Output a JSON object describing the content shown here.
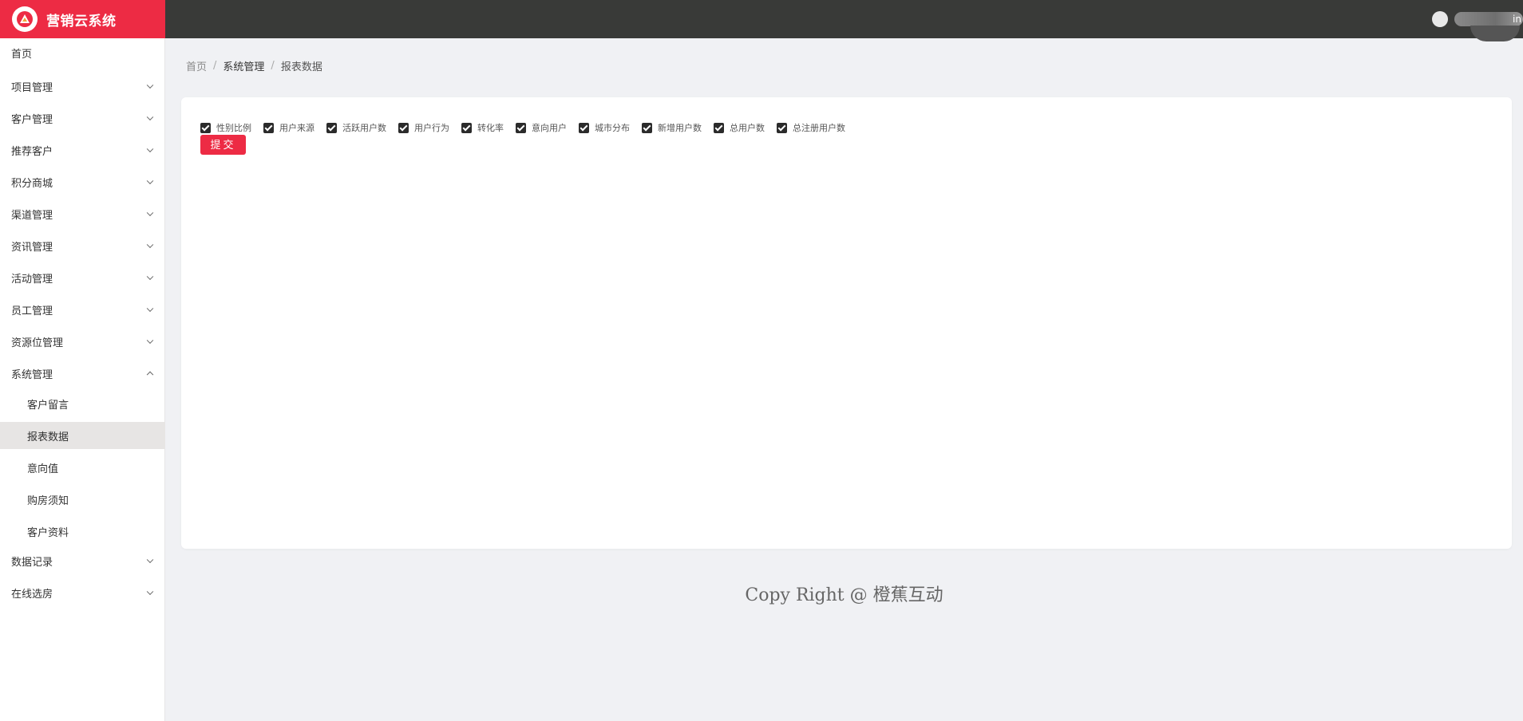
{
  "brand": {
    "title": "营销云系统",
    "logo_icon": "brand-triangle-logo"
  },
  "user": {
    "name_visible": "in"
  },
  "sidebar": {
    "items": [
      {
        "label": "首页",
        "expandable": false
      },
      {
        "label": "项目管理",
        "expandable": true
      },
      {
        "label": "客户管理",
        "expandable": true
      },
      {
        "label": "推荐客户",
        "expandable": true
      },
      {
        "label": "积分商城",
        "expandable": true
      },
      {
        "label": "渠道管理",
        "expandable": true
      },
      {
        "label": "资讯管理",
        "expandable": true
      },
      {
        "label": "活动管理",
        "expandable": true
      },
      {
        "label": "员工管理",
        "expandable": true
      },
      {
        "label": "资源位管理",
        "expandable": true
      },
      {
        "label": "系统管理",
        "expandable": true,
        "expanded": true
      },
      {
        "label": "数据记录",
        "expandable": true
      },
      {
        "label": "在线选房",
        "expandable": true
      }
    ],
    "system_children": [
      {
        "label": "客户留言"
      },
      {
        "label": "报表数据",
        "active": true
      },
      {
        "label": "意向值"
      },
      {
        "label": "购房须知"
      },
      {
        "label": "客户资料"
      }
    ]
  },
  "breadcrumb": {
    "items": [
      "首页",
      "系统管理",
      "报表数据"
    ],
    "separator": "/"
  },
  "report_options": {
    "checkboxes": [
      {
        "label": "性别比例",
        "checked": true
      },
      {
        "label": "用户来源",
        "checked": true
      },
      {
        "label": "活跃用户数",
        "checked": true
      },
      {
        "label": "用户行为",
        "checked": true
      },
      {
        "label": "转化率",
        "checked": true
      },
      {
        "label": "意向用户",
        "checked": true
      },
      {
        "label": "城市分布",
        "checked": true
      },
      {
        "label": "新增用户数",
        "checked": true
      },
      {
        "label": "总用户数",
        "checked": true
      },
      {
        "label": "总注册用户数",
        "checked": true
      }
    ],
    "submit_label": "提交"
  },
  "footer": {
    "text": "Copy Right @ 橙蕉互动"
  },
  "colors": {
    "brand_red": "#ed2b44",
    "topbar_dark": "#393a38",
    "page_bg": "#f0f1f4",
    "active_item_bg": "#e7e5e4"
  }
}
